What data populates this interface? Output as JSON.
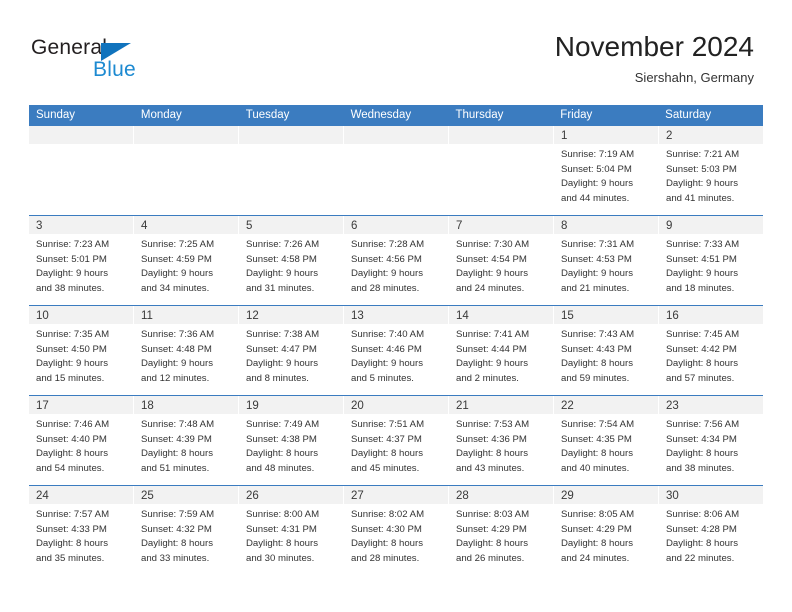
{
  "brand": {
    "name_top": "General",
    "name_bottom": "Blue",
    "triangle_color": "#1073bd",
    "blue_text_color": "#1d8ad1"
  },
  "header": {
    "title": "November 2024",
    "subtitle": "Siershahn, Germany"
  },
  "theme": {
    "header_blue": "#3b7cc0",
    "day_band_gray": "#f2f2f2",
    "text_color": "#333333"
  },
  "weekdays": [
    "Sunday",
    "Monday",
    "Tuesday",
    "Wednesday",
    "Thursday",
    "Friday",
    "Saturday"
  ],
  "weeks": [
    [
      {
        "day": "",
        "lines": []
      },
      {
        "day": "",
        "lines": []
      },
      {
        "day": "",
        "lines": []
      },
      {
        "day": "",
        "lines": []
      },
      {
        "day": "",
        "lines": []
      },
      {
        "day": "1",
        "lines": [
          "Sunrise: 7:19 AM",
          "Sunset: 5:04 PM",
          "Daylight: 9 hours",
          "and 44 minutes."
        ]
      },
      {
        "day": "2",
        "lines": [
          "Sunrise: 7:21 AM",
          "Sunset: 5:03 PM",
          "Daylight: 9 hours",
          "and 41 minutes."
        ]
      }
    ],
    [
      {
        "day": "3",
        "lines": [
          "Sunrise: 7:23 AM",
          "Sunset: 5:01 PM",
          "Daylight: 9 hours",
          "and 38 minutes."
        ]
      },
      {
        "day": "4",
        "lines": [
          "Sunrise: 7:25 AM",
          "Sunset: 4:59 PM",
          "Daylight: 9 hours",
          "and 34 minutes."
        ]
      },
      {
        "day": "5",
        "lines": [
          "Sunrise: 7:26 AM",
          "Sunset: 4:58 PM",
          "Daylight: 9 hours",
          "and 31 minutes."
        ]
      },
      {
        "day": "6",
        "lines": [
          "Sunrise: 7:28 AM",
          "Sunset: 4:56 PM",
          "Daylight: 9 hours",
          "and 28 minutes."
        ]
      },
      {
        "day": "7",
        "lines": [
          "Sunrise: 7:30 AM",
          "Sunset: 4:54 PM",
          "Daylight: 9 hours",
          "and 24 minutes."
        ]
      },
      {
        "day": "8",
        "lines": [
          "Sunrise: 7:31 AM",
          "Sunset: 4:53 PM",
          "Daylight: 9 hours",
          "and 21 minutes."
        ]
      },
      {
        "day": "9",
        "lines": [
          "Sunrise: 7:33 AM",
          "Sunset: 4:51 PM",
          "Daylight: 9 hours",
          "and 18 minutes."
        ]
      }
    ],
    [
      {
        "day": "10",
        "lines": [
          "Sunrise: 7:35 AM",
          "Sunset: 4:50 PM",
          "Daylight: 9 hours",
          "and 15 minutes."
        ]
      },
      {
        "day": "11",
        "lines": [
          "Sunrise: 7:36 AM",
          "Sunset: 4:48 PM",
          "Daylight: 9 hours",
          "and 12 minutes."
        ]
      },
      {
        "day": "12",
        "lines": [
          "Sunrise: 7:38 AM",
          "Sunset: 4:47 PM",
          "Daylight: 9 hours",
          "and 8 minutes."
        ]
      },
      {
        "day": "13",
        "lines": [
          "Sunrise: 7:40 AM",
          "Sunset: 4:46 PM",
          "Daylight: 9 hours",
          "and 5 minutes."
        ]
      },
      {
        "day": "14",
        "lines": [
          "Sunrise: 7:41 AM",
          "Sunset: 4:44 PM",
          "Daylight: 9 hours",
          "and 2 minutes."
        ]
      },
      {
        "day": "15",
        "lines": [
          "Sunrise: 7:43 AM",
          "Sunset: 4:43 PM",
          "Daylight: 8 hours",
          "and 59 minutes."
        ]
      },
      {
        "day": "16",
        "lines": [
          "Sunrise: 7:45 AM",
          "Sunset: 4:42 PM",
          "Daylight: 8 hours",
          "and 57 minutes."
        ]
      }
    ],
    [
      {
        "day": "17",
        "lines": [
          "Sunrise: 7:46 AM",
          "Sunset: 4:40 PM",
          "Daylight: 8 hours",
          "and 54 minutes."
        ]
      },
      {
        "day": "18",
        "lines": [
          "Sunrise: 7:48 AM",
          "Sunset: 4:39 PM",
          "Daylight: 8 hours",
          "and 51 minutes."
        ]
      },
      {
        "day": "19",
        "lines": [
          "Sunrise: 7:49 AM",
          "Sunset: 4:38 PM",
          "Daylight: 8 hours",
          "and 48 minutes."
        ]
      },
      {
        "day": "20",
        "lines": [
          "Sunrise: 7:51 AM",
          "Sunset: 4:37 PM",
          "Daylight: 8 hours",
          "and 45 minutes."
        ]
      },
      {
        "day": "21",
        "lines": [
          "Sunrise: 7:53 AM",
          "Sunset: 4:36 PM",
          "Daylight: 8 hours",
          "and 43 minutes."
        ]
      },
      {
        "day": "22",
        "lines": [
          "Sunrise: 7:54 AM",
          "Sunset: 4:35 PM",
          "Daylight: 8 hours",
          "and 40 minutes."
        ]
      },
      {
        "day": "23",
        "lines": [
          "Sunrise: 7:56 AM",
          "Sunset: 4:34 PM",
          "Daylight: 8 hours",
          "and 38 minutes."
        ]
      }
    ],
    [
      {
        "day": "24",
        "lines": [
          "Sunrise: 7:57 AM",
          "Sunset: 4:33 PM",
          "Daylight: 8 hours",
          "and 35 minutes."
        ]
      },
      {
        "day": "25",
        "lines": [
          "Sunrise: 7:59 AM",
          "Sunset: 4:32 PM",
          "Daylight: 8 hours",
          "and 33 minutes."
        ]
      },
      {
        "day": "26",
        "lines": [
          "Sunrise: 8:00 AM",
          "Sunset: 4:31 PM",
          "Daylight: 8 hours",
          "and 30 minutes."
        ]
      },
      {
        "day": "27",
        "lines": [
          "Sunrise: 8:02 AM",
          "Sunset: 4:30 PM",
          "Daylight: 8 hours",
          "and 28 minutes."
        ]
      },
      {
        "day": "28",
        "lines": [
          "Sunrise: 8:03 AM",
          "Sunset: 4:29 PM",
          "Daylight: 8 hours",
          "and 26 minutes."
        ]
      },
      {
        "day": "29",
        "lines": [
          "Sunrise: 8:05 AM",
          "Sunset: 4:29 PM",
          "Daylight: 8 hours",
          "and 24 minutes."
        ]
      },
      {
        "day": "30",
        "lines": [
          "Sunrise: 8:06 AM",
          "Sunset: 4:28 PM",
          "Daylight: 8 hours",
          "and 22 minutes."
        ]
      }
    ]
  ]
}
